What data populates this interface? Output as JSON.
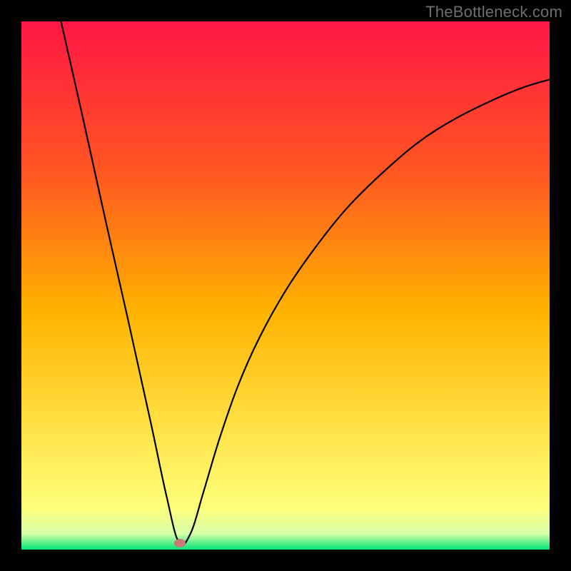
{
  "watermark": "TheBottleneck.com",
  "chart_data": {
    "type": "line",
    "title": "",
    "xlabel": "",
    "ylabel": "",
    "xlim": [
      0,
      1
    ],
    "ylim": [
      0,
      1
    ],
    "gradient_colors": {
      "top": "#ff1744",
      "upper_mid": "#ff5522",
      "mid": "#ffb300",
      "lower_mid": "#ffe44a",
      "lower": "#fdff7a",
      "bottom_band_light": "#d8ffa8",
      "bottom_band": "#00e676"
    },
    "curve_description": "V-shaped curve: steep linear descent from top-left to a minimum near x≈0.30, then smooth concave rise toward upper-right",
    "curve_points": [
      {
        "x": 0.075,
        "y": 1.0
      },
      {
        "x": 0.118,
        "y": 0.81
      },
      {
        "x": 0.16,
        "y": 0.62
      },
      {
        "x": 0.203,
        "y": 0.43
      },
      {
        "x": 0.245,
        "y": 0.24
      },
      {
        "x": 0.275,
        "y": 0.1
      },
      {
        "x": 0.298,
        "y": 0.014
      },
      {
        "x": 0.32,
        "y": 0.03
      },
      {
        "x": 0.345,
        "y": 0.11
      },
      {
        "x": 0.375,
        "y": 0.21
      },
      {
        "x": 0.41,
        "y": 0.31
      },
      {
        "x": 0.45,
        "y": 0.4
      },
      {
        "x": 0.5,
        "y": 0.49
      },
      {
        "x": 0.555,
        "y": 0.57
      },
      {
        "x": 0.615,
        "y": 0.645
      },
      {
        "x": 0.68,
        "y": 0.71
      },
      {
        "x": 0.75,
        "y": 0.77
      },
      {
        "x": 0.82,
        "y": 0.815
      },
      {
        "x": 0.89,
        "y": 0.85
      },
      {
        "x": 0.95,
        "y": 0.875
      },
      {
        "x": 1.0,
        "y": 0.89
      }
    ],
    "marker": {
      "x": 0.3,
      "y": 0.012,
      "color": "#c77a77"
    }
  }
}
